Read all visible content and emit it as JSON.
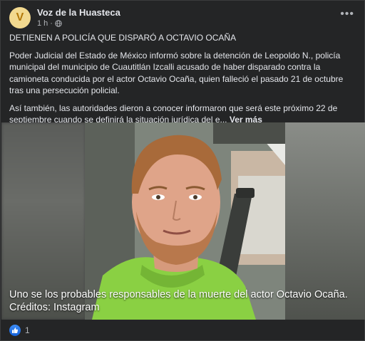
{
  "post": {
    "page_name": "Voz de la Huasteca",
    "avatar_letter": "V",
    "time": "1 h",
    "separator": "·",
    "headline": "DETIENEN A POLICÍA QUE DISPARÓ A OCTAVIO OCAÑA",
    "paragraph1": "Poder Judicial del Estado de México informó sobre la detención de Leopoldo N., policía municipal del municipio de Cuautitlán Izcalli acusado de haber disparado contra la camioneta conducida por el actor Octavio Ocaña, quien falleció el pasado 21 de octubre tras una persecución policial.",
    "paragraph2": "Así también, las autoridades dieron a conocer informaron que será este próximo 22 de septiembre cuando se definirá la situación jurídica del e...",
    "see_more": "Ver más",
    "caption_line1": "Uno se los probables responsables de la muerte del actor Octavio Ocaña.",
    "caption_line2": "Créditos: Instagram",
    "reaction_count": "1",
    "reaction_icon": "like-icon"
  },
  "colors": {
    "background": "#242526",
    "text": "#e4e6eb",
    "secondary_text": "#b0b3b8",
    "like_blue": "#1877f2"
  }
}
